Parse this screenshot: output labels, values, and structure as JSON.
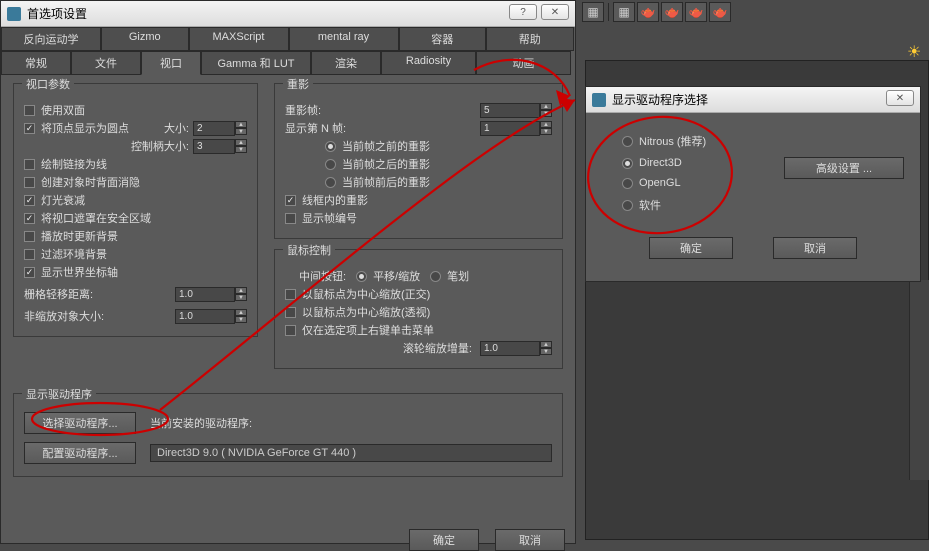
{
  "toolbar_icons": [
    "▦",
    "▦",
    "☕",
    "☕",
    "☕",
    "|"
  ],
  "prefs": {
    "title": "首选项设置",
    "tabs_row1": [
      "反向运动学",
      "Gizmo",
      "MAXScript",
      "mental ray",
      "容器",
      "帮助"
    ],
    "tabs_row2": [
      "常规",
      "文件",
      "视口",
      "Gamma 和 LUT",
      "渲染",
      "Radiosity",
      "动画"
    ],
    "active_tab": "视口",
    "viewport_params": {
      "title": "视口参数",
      "use_dual_planes": "使用双面",
      "display_vert_dots": "将顶点显示为圆点",
      "size_label": "大小:",
      "size_val": "2",
      "handle_size_label": "控制柄大小:",
      "handle_size_val": "3",
      "draw_links": "绘制链接为线",
      "backface_cull": "创建对象时背面消隐",
      "light_attenuation": "灯光衰减",
      "mask_safe": "将视口遮罩在安全区域",
      "update_bg": "播放时更新背景",
      "filter_env": "过滤环境背景",
      "display_world_axis": "显示世界坐标轴",
      "grid_dist_label": "栅格轻移距离:",
      "grid_dist_val": "1.0",
      "non_scale_label": "非缩放对象大小:",
      "non_scale_val": "1.0"
    },
    "ghosting": {
      "title": "重影",
      "frames_label": "重影帧:",
      "frames_val": "5",
      "nth_label": "显示第 N 帧:",
      "nth_val": "1",
      "before": "当前帧之前的重影",
      "after": "当前帧之后的重影",
      "both": "当前帧前后的重影",
      "wireframe": "线框内的重影",
      "frame_num": "显示帧编号"
    },
    "mouse": {
      "title": "鼠标控制",
      "mid_btn_label": "中间按钮:",
      "pan_zoom": "平移/缩放",
      "stroke": "笔划",
      "center_ortho": "以鼠标点为中心缩放(正交)",
      "center_persp": "以鼠标点为中心缩放(透视)",
      "rt_click_sel": "仅在选定项上右键单击菜单",
      "wheel_label": "滚轮缩放增量:",
      "wheel_val": "1.0"
    },
    "driver": {
      "title": "显示驱动程序",
      "choose_btn": "选择驱动程序...",
      "current_label": "当前安装的驱动程序:",
      "config_btn": "配置驱动程序...",
      "current_val": "Direct3D 9.0 ( NVIDIA GeForce GT 440 )"
    },
    "ok": "确定",
    "cancel": "取消"
  },
  "drv_dialog": {
    "title": "显示驱动程序选择",
    "nitrous": "Nitrous (推荐)",
    "d3d": "Direct3D",
    "opengl": "OpenGL",
    "software": "软件",
    "adv": "高级设置 ...",
    "ok": "确定",
    "cancel": "取消"
  }
}
